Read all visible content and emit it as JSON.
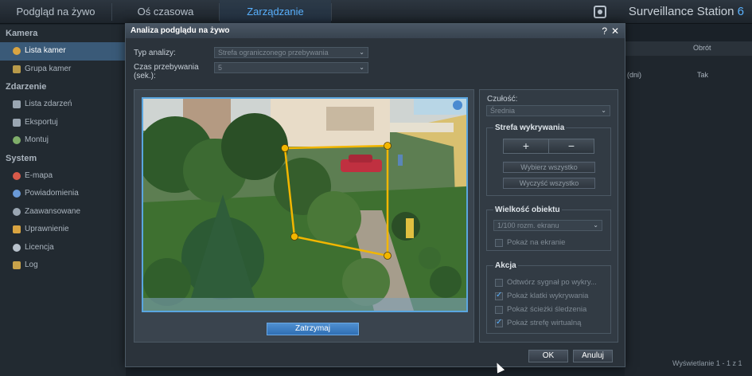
{
  "top_tabs": [
    "Podgląd na żywo",
    "Oś czasowa",
    "Zarządzanie"
  ],
  "brand": {
    "name": "Surveillance Station",
    "version": "6"
  },
  "sidebar": {
    "sections": [
      {
        "title": "Kamera",
        "items": [
          {
            "label": "Lista kamer",
            "active": true
          },
          {
            "label": "Grupa kamer"
          }
        ]
      },
      {
        "title": "Zdarzenie",
        "items": [
          {
            "label": "Lista zdarzeń"
          },
          {
            "label": "Eksportuj"
          },
          {
            "label": "Montuj"
          }
        ]
      },
      {
        "title": "System",
        "items": [
          {
            "label": "E-mapa"
          },
          {
            "label": "Powiadomienia"
          },
          {
            "label": "Zaawansowane"
          },
          {
            "label": "Uprawnienie"
          },
          {
            "label": "Licencja"
          },
          {
            "label": "Log"
          }
        ]
      }
    ]
  },
  "background": {
    "col_header": "Obrót",
    "cell_days": "(dni)",
    "cell_yes": "Tak",
    "footer": "Wyświetlanie 1 - 1 z 1"
  },
  "modal": {
    "title": "Analiza podglądu na żywo",
    "help": "?",
    "close": "✕",
    "analysis_type_label": "Typ analizy:",
    "analysis_type_value": "Strefa ograniczonego przebywania",
    "dwell_time_label_1": "Czas przebywania",
    "dwell_time_label_2": "(sek.):",
    "dwell_time_value": "5",
    "stop_button": "Zatrzymaj",
    "sensitivity_label": "Czułość:",
    "sensitivity_value": "Średnia",
    "detection_zone": {
      "title": "Strefa wykrywania",
      "plus": "+",
      "minus": "−",
      "select_all": "Wybierz wszystko",
      "clear_all": "Wyczyść wszystko"
    },
    "object_size": {
      "title": "Wielkość obiektu",
      "value": "1/100 rozm. ekranu",
      "show_on_screen": "Pokaż na ekranie"
    },
    "action": {
      "title": "Akcja",
      "items": [
        {
          "label": "Odtwórz sygnał po wykry...",
          "checked": false
        },
        {
          "label": "Pokaż klatki wykrywania",
          "checked": true
        },
        {
          "label": "Pokaż ścieżki śledzenia",
          "checked": false
        },
        {
          "label": "Pokaż strefę wirtualną",
          "checked": true
        }
      ]
    },
    "ok": "OK",
    "cancel": "Anuluj"
  },
  "colors": {
    "accent": "#5ab2ff",
    "zone_line": "#f2b600"
  }
}
